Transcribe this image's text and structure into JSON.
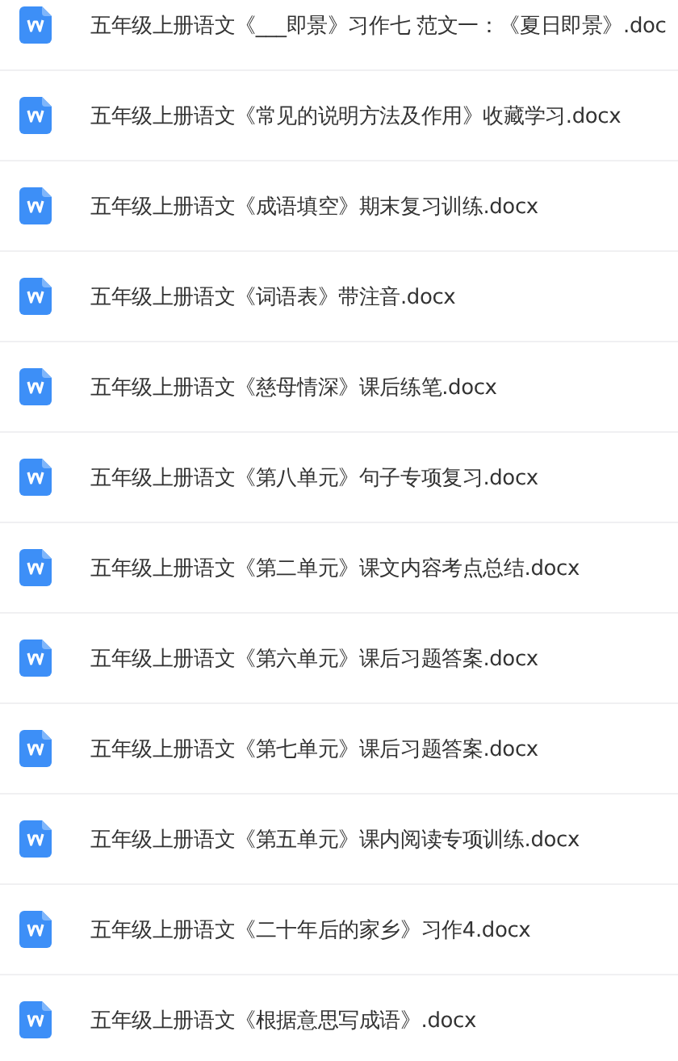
{
  "files": [
    {
      "name": "五年级上册语文《___即景》习作七 范文一：《夏日即景》.doc"
    },
    {
      "name": "五年级上册语文《常见的说明方法及作用》收藏学习.docx"
    },
    {
      "name": "五年级上册语文《成语填空》期末复习训练.docx"
    },
    {
      "name": "五年级上册语文《词语表》带注音.docx"
    },
    {
      "name": "五年级上册语文《慈母情深》课后练笔.docx"
    },
    {
      "name": "五年级上册语文《第八单元》句子专项复习.docx"
    },
    {
      "name": "五年级上册语文《第二单元》课文内容考点总结.docx"
    },
    {
      "name": "五年级上册语文《第六单元》课后习题答案.docx"
    },
    {
      "name": "五年级上册语文《第七单元》课后习题答案.docx"
    },
    {
      "name": "五年级上册语文《第五单元》课内阅读专项训练.docx"
    },
    {
      "name": "五年级上册语文《二十年后的家乡》习作4.docx"
    },
    {
      "name": "五年级上册语文《根据意思写成语》.docx"
    }
  ]
}
